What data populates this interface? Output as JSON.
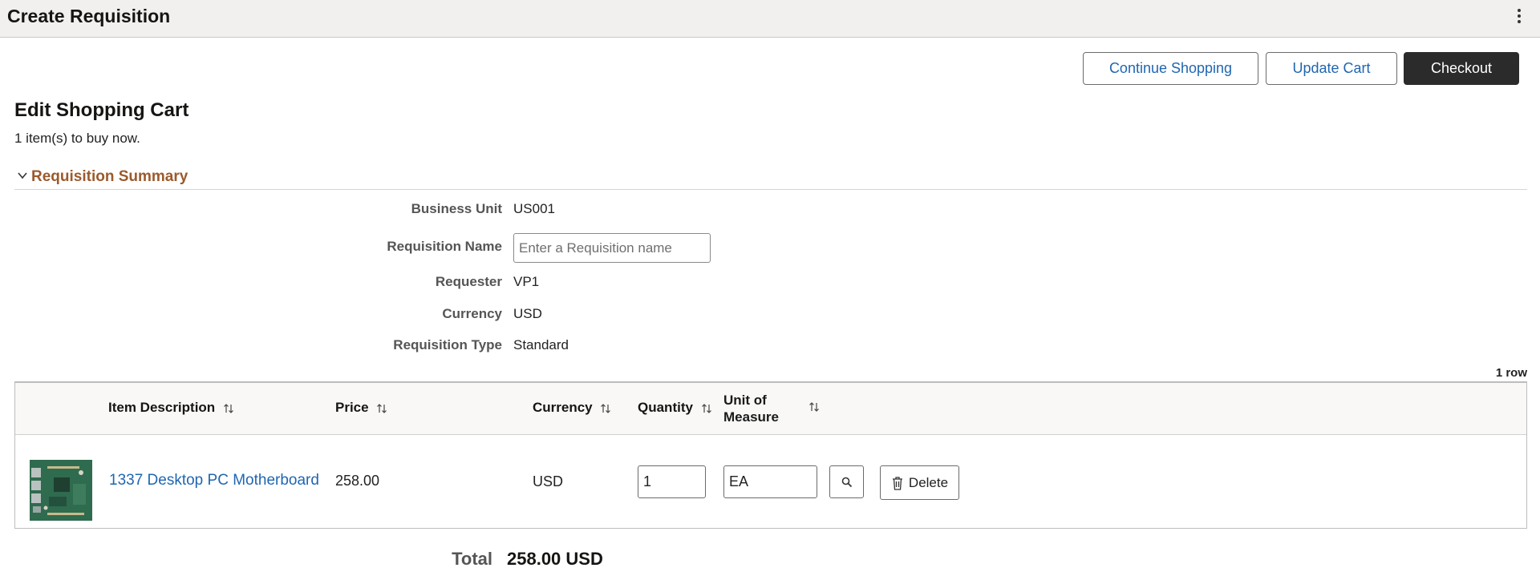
{
  "app": {
    "title": "Create Requisition"
  },
  "toolbar": {
    "continue_label": "Continue Shopping",
    "update_label": "Update Cart",
    "checkout_label": "Checkout"
  },
  "page": {
    "title": "Edit Shopping Cart",
    "item_count_text": "1 item(s) to buy now."
  },
  "summary": {
    "header": "Requisition Summary",
    "fields": {
      "business_unit": {
        "label": "Business Unit",
        "value": "US001"
      },
      "requisition_name": {
        "label": "Requisition Name",
        "value": "",
        "placeholder": "Enter a Requisition name"
      },
      "requester": {
        "label": "Requester",
        "value": "VP1"
      },
      "currency": {
        "label": "Currency",
        "value": "USD"
      },
      "requisition_type": {
        "label": "Requisition Type",
        "value": "Standard"
      }
    }
  },
  "grid": {
    "row_count": "1 row",
    "columns": {
      "item_description": "Item Description",
      "price": "Price",
      "currency": "Currency",
      "quantity": "Quantity",
      "uom_line1": "Unit of",
      "uom_line2": "Measure"
    },
    "rows": [
      {
        "item_description": "1337 Desktop PC Motherboard",
        "price": "258.00",
        "currency": "USD",
        "quantity": "1",
        "uom": "EA",
        "delete_label": "Delete"
      }
    ]
  },
  "totals": {
    "label": "Total",
    "value": "258.00 USD"
  },
  "icons": {
    "more": "kebab-icon",
    "expand": "chevron-down-icon",
    "sort": "sort-icon",
    "search": "search-icon",
    "delete": "trash-icon",
    "product": "motherboard-thumbnail"
  },
  "colors": {
    "link": "#1f66b1",
    "section_header": "#9b5a2d",
    "primary_button": "#2b2b2b",
    "titlebar": "#f1f0ee"
  }
}
